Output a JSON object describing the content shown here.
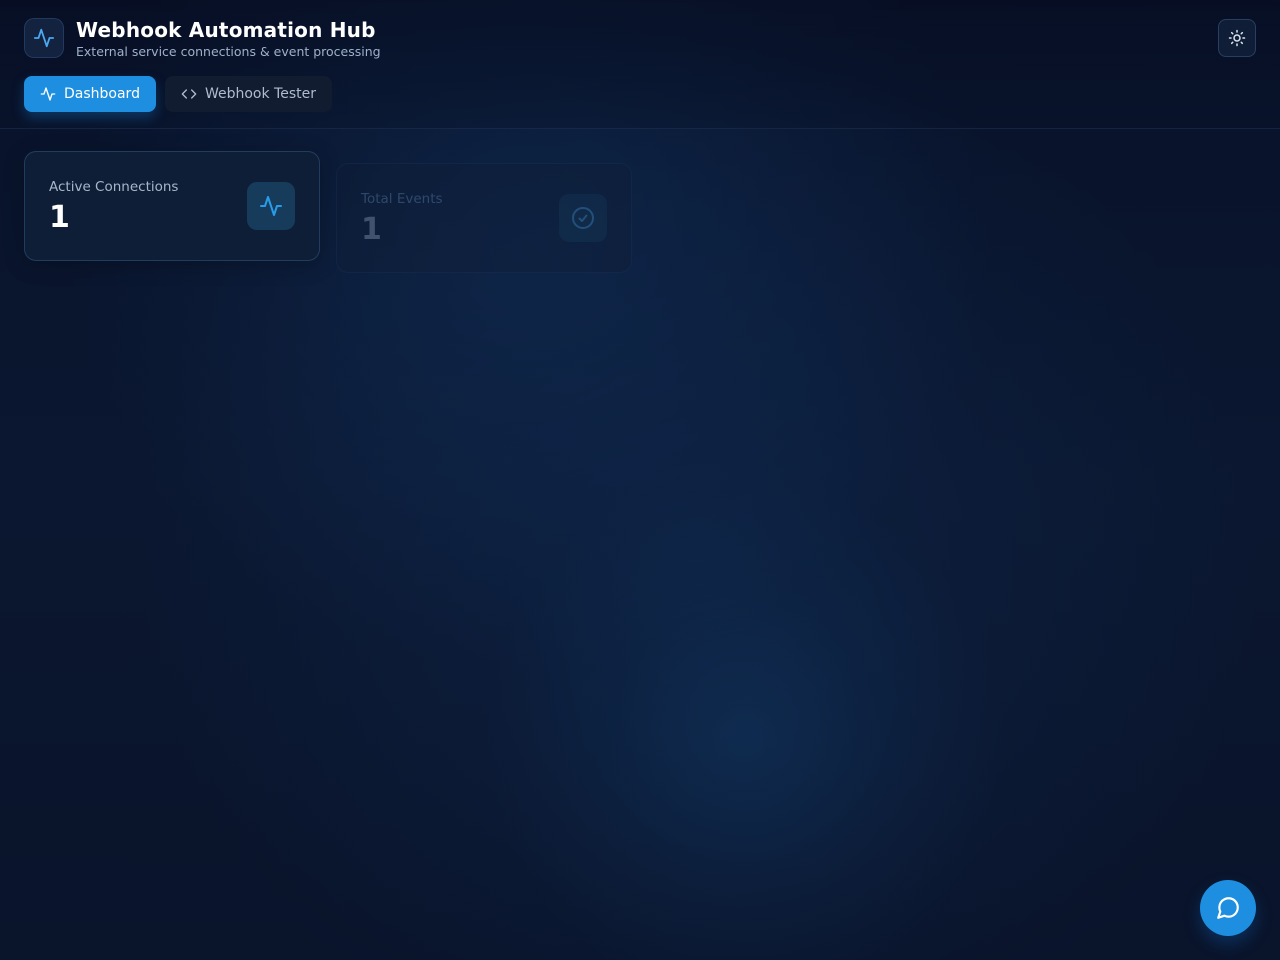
{
  "header": {
    "title": "Webhook Automation Hub",
    "subtitle": "External service connections & event processing",
    "logo_icon": "activity-icon",
    "theme_toggle_icon": "sun-icon"
  },
  "tabs": [
    {
      "label": "Dashboard",
      "icon": "activity-icon",
      "active": true
    },
    {
      "label": "Webhook Tester",
      "icon": "code-icon",
      "active": false
    }
  ],
  "stats": [
    {
      "label": "Active Connections",
      "value": "1",
      "icon": "activity-icon"
    },
    {
      "label": "Total Events",
      "value": "1",
      "icon": "check-circle-icon"
    }
  ],
  "chat": {
    "icon": "message-circle-icon"
  },
  "colors": {
    "accent": "#1e8fe0",
    "background": "#0b1730",
    "card": "#0f1e37"
  }
}
